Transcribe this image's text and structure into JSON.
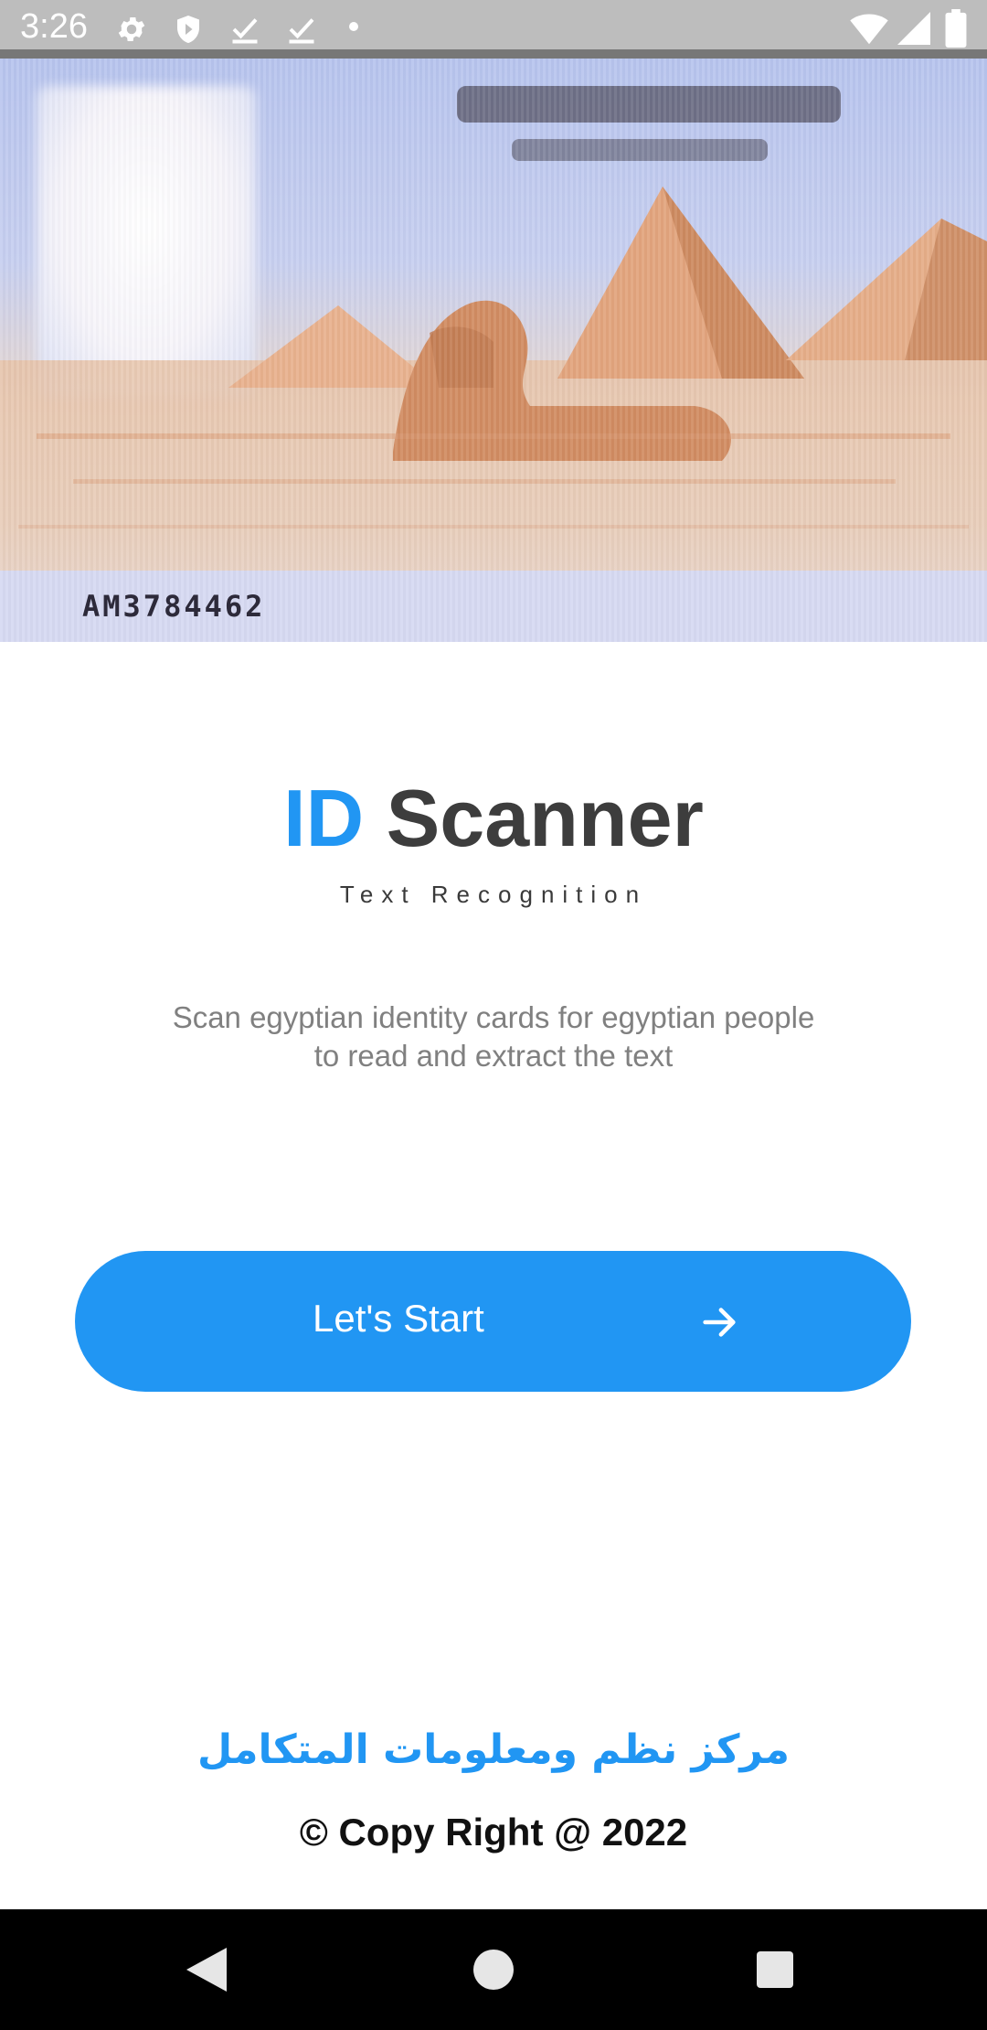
{
  "status_bar": {
    "time": "3:26",
    "icons": [
      "gear-icon",
      "shield-icon",
      "check-icon",
      "check-icon",
      "dot-icon",
      "wifi-icon",
      "signal-icon",
      "battery-icon"
    ]
  },
  "hero": {
    "card_number": "AM3784462",
    "image_description_icon": "egyptian-id-card-image"
  },
  "title": {
    "part1": "ID",
    "part2": "Scanner",
    "subtitle": "Text Recognition",
    "accent_color": "#2196f3"
  },
  "description": {
    "line1": "Scan egyptian identity cards for egyptian people",
    "line2": "to read and extract the text"
  },
  "start_button": {
    "label": "Let's Start",
    "icon": "arrow-right-icon",
    "color": "#2196f3"
  },
  "footer": {
    "arabic_text": "مركز نظم ومعلومات المتكامل",
    "copyright": "© Copy Right @ 2022"
  },
  "nav_bar": {
    "buttons": [
      "back-icon",
      "home-icon",
      "recents-icon"
    ]
  }
}
